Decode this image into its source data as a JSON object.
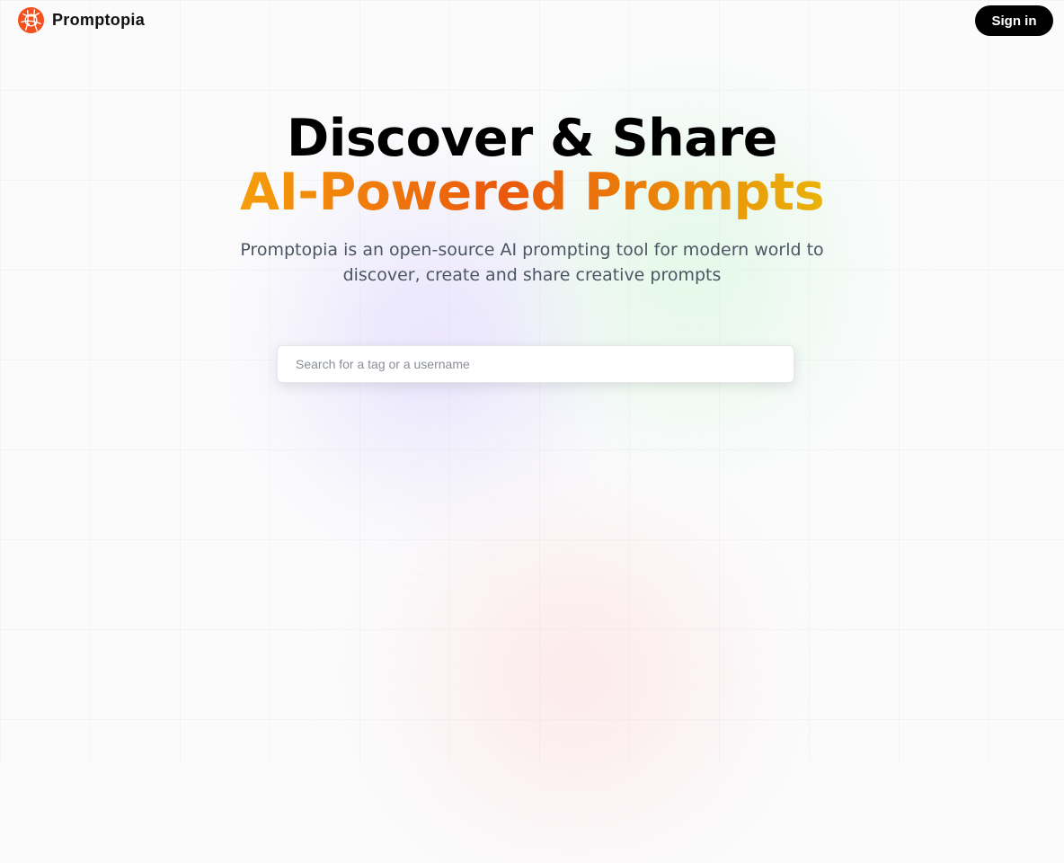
{
  "brand": {
    "name": "Promptopia",
    "logo_icon": "globe-network-icon",
    "accent": "#f4511e"
  },
  "nav": {
    "signin_label": "Sign in"
  },
  "hero": {
    "title_line1": "Discover & Share",
    "title_line2": "AI-Powered Prompts",
    "description": "Promptopia is an open-source AI prompting tool for modern world to discover, create and share creative prompts",
    "gradient_colors": [
      "#f59e0b",
      "#ea580c",
      "#eab308"
    ]
  },
  "search": {
    "placeholder": "Search for a tag or a username",
    "value": ""
  }
}
